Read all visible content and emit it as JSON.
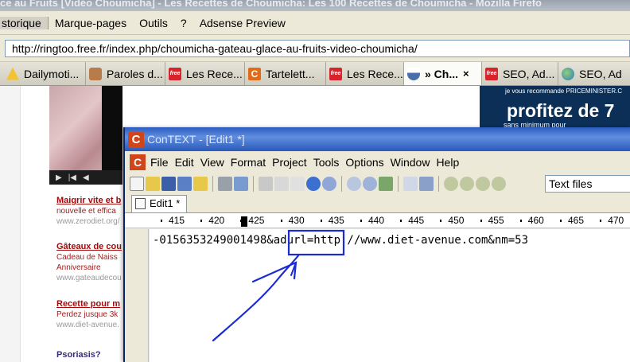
{
  "browser": {
    "title_fragment": "ce au Fruits [Vidéo Choumicha] - Les Recettes de Choumicha: Les 100 Recettes de Choumicha - Mozilla Firefo",
    "menu": [
      "storique",
      "Marque-pages",
      "Outils",
      "?",
      "Adsense Preview"
    ],
    "url": "http://ringtoo.free.fr/index.php/choumicha-gateau-glace-au-fruits-video-choumicha/",
    "tabs": [
      {
        "label": "Dailymoti...",
        "icon": "warning-icon"
      },
      {
        "label": "Paroles d...",
        "icon": "avatar-icon"
      },
      {
        "label": "Les Rece...",
        "icon": "free-icon"
      },
      {
        "label": "Tartelett...",
        "icon": "context-icon"
      },
      {
        "label": "Les Rece...",
        "icon": "free-icon"
      },
      {
        "label": "» Ch...",
        "icon": "bowl-icon",
        "selected": true
      },
      {
        "label": "SEO, Ad...",
        "icon": "free-icon"
      },
      {
        "label": "SEO, Ad",
        "icon": "globe-icon"
      }
    ],
    "close_glyph": "×"
  },
  "page": {
    "ads": [
      {
        "title": "Maigrir vite et b",
        "desc": "nouvelle et effica",
        "url": "www.zerodiet.org/"
      },
      {
        "title": "Gâteaux de cou",
        "desc": "Cadeau de Naiss",
        "desc2": "Anniversaire",
        "url": "www.gateaudecou"
      },
      {
        "title": "Recette pour m",
        "desc": "Perdez jusque 3k",
        "url": "www.diet-avenue."
      }
    ],
    "psoriasis": "Psoriasis?",
    "banner": {
      "line1": "je vous recommande PRICEMINISTER.C",
      "line2": "profitez de 7",
      "line3": "sans minimum pour"
    }
  },
  "context": {
    "title": "ConTEXT - [Edit1 *]",
    "menu": [
      "File",
      "Edit",
      "View",
      "Format",
      "Project",
      "Tools",
      "Options",
      "Window",
      "Help"
    ],
    "filter": "Text files",
    "tab": "Edit1 *",
    "ruler": [
      "415",
      "420",
      "425",
      "430",
      "435",
      "440",
      "445",
      "450",
      "455",
      "460",
      "465",
      "470"
    ],
    "code": "-0156353249001498&adurl=http://www.diet-avenue.com&nm=53"
  },
  "colors": {
    "annotation": "#1a2bd6",
    "title_bar": "#2c5bc0"
  }
}
